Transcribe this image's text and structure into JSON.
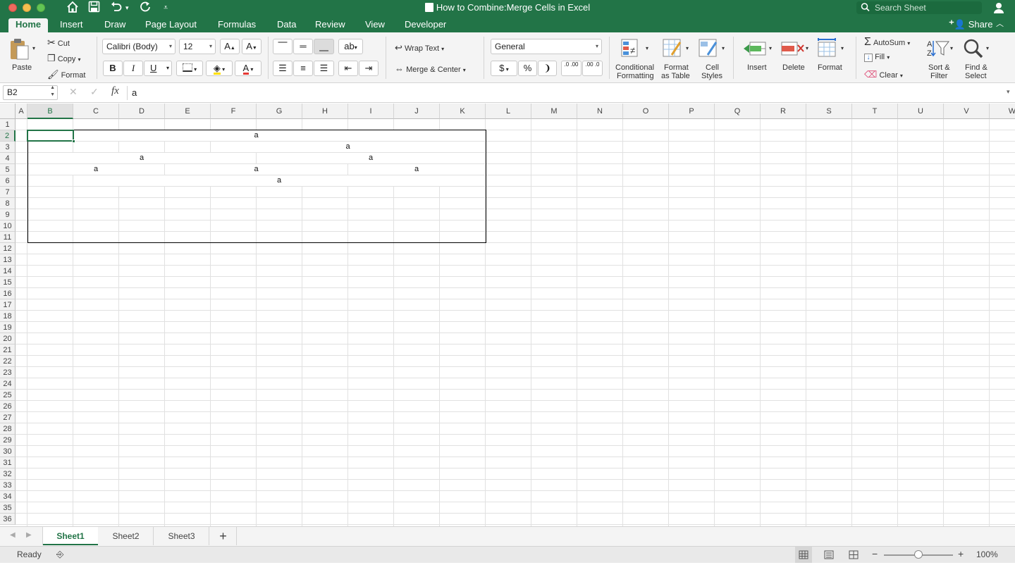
{
  "window": {
    "title": "How to Combine:Merge Cells in Excel",
    "search_placeholder": "Search Sheet",
    "share_label": "Share"
  },
  "ribbon_tabs": [
    "Home",
    "Insert",
    "Draw",
    "Page Layout",
    "Formulas",
    "Data",
    "Review",
    "View",
    "Developer"
  ],
  "clipboard": {
    "paste": "Paste",
    "cut": "Cut",
    "copy": "Copy",
    "format": "Format"
  },
  "font": {
    "name": "Calibri (Body)",
    "size": "12",
    "bold": "B",
    "italic": "I",
    "underline": "U",
    "grow": "A",
    "shrink": "A",
    "font_color": "A"
  },
  "alignment": {
    "wrap_text": "Wrap Text",
    "merge_center": "Merge & Center"
  },
  "number": {
    "format": "General",
    "currency": "$",
    "percent": "%",
    "comma": "❩",
    "inc_dec": ".0 .00",
    "dec_dec": ".00 .0"
  },
  "styles": {
    "conditional": "Conditional",
    "conditional2": "Formatting",
    "as_table": "Format",
    "as_table2": "as Table",
    "cell_styles": "Cell",
    "cell_styles2": "Styles"
  },
  "cells": {
    "insert": "Insert",
    "delete": "Delete",
    "format": "Format"
  },
  "editing": {
    "autosum": "AutoSum",
    "fill": "Fill",
    "clear": "Clear",
    "sort": "Sort &",
    "sort2": "Filter",
    "find": "Find &",
    "find2": "Select"
  },
  "formula_bar": {
    "name_box": "B2",
    "fx": "fx",
    "content": "a"
  },
  "columns": [
    "A",
    "B",
    "C",
    "D",
    "E",
    "F",
    "G",
    "H",
    "I",
    "J",
    "K",
    "L",
    "M",
    "N",
    "O",
    "P",
    "Q",
    "R",
    "S",
    "T",
    "U",
    "V",
    "W"
  ],
  "rows": [
    "1",
    "2",
    "3",
    "4",
    "5",
    "6",
    "7",
    "8",
    "9",
    "10",
    "11",
    "12",
    "13",
    "14",
    "15",
    "16",
    "17",
    "18",
    "19",
    "20",
    "21",
    "22",
    "23",
    "24",
    "25",
    "26",
    "27",
    "28",
    "29",
    "30",
    "31",
    "32",
    "33",
    "34",
    "35",
    "36"
  ],
  "merged_values": [
    "a",
    "a",
    "a",
    "a",
    "a",
    "a",
    "a",
    "a"
  ],
  "sheets": [
    "Sheet1",
    "Sheet2",
    "Sheet3"
  ],
  "add_sheet": "+",
  "status": {
    "ready": "Ready",
    "zoom": "100%",
    "minus": "−",
    "plus": "+"
  },
  "colors": {
    "accent": "#227447",
    "ribbon_bg": "#f4f4f4"
  }
}
